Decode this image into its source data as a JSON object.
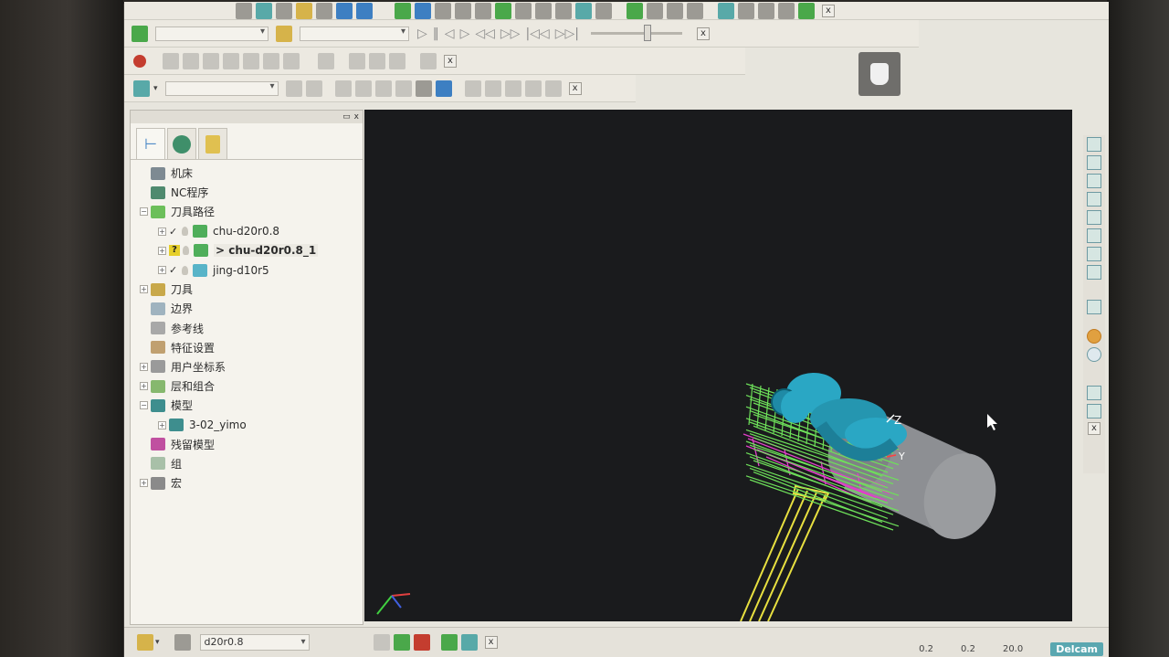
{
  "toolbars": {
    "close_label": "x"
  },
  "explorer": {
    "tabs": [
      {
        "name": "tree-tab",
        "icon": "tree-icon"
      },
      {
        "name": "globe-tab",
        "icon": "globe-icon"
      },
      {
        "name": "bin-tab",
        "icon": "bin-icon"
      }
    ],
    "tree": {
      "machine": "机床",
      "nc_program": "NC程序",
      "toolpaths": "刀具路径",
      "toolpath_items": [
        {
          "label": "chu-d20r0.8",
          "check": "✓",
          "active": false
        },
        {
          "label": "> chu-d20r0.8_1",
          "check": "?",
          "active": true
        },
        {
          "label": "jing-d10r5",
          "check": "✓",
          "active": false
        }
      ],
      "tools": "刀具",
      "boundaries": "边界",
      "reference_lines": "参考线",
      "feature_settings": "特征设置",
      "user_coordinates": "用户坐标系",
      "levels": "层和组合",
      "models": "模型",
      "model_items": [
        "3-02_yimo"
      ],
      "stock_model": "残留模型",
      "groups": "组",
      "macros": "宏"
    }
  },
  "viewport": {
    "axis_z": "Z",
    "axis_y": "Y"
  },
  "statusbar": {
    "tool_name": "d20r0.8",
    "val1": "0.2",
    "val2": "0.2",
    "val3": "20.0",
    "brand": "Delcam"
  },
  "colors": {
    "viewport_bg": "#1a1b1d",
    "model": "#2aa7c4",
    "stock": "#8d8f93",
    "toolpath_green": "#6ee05a",
    "toolpath_magenta": "#e040c8",
    "lead_yellow": "#e8e040"
  }
}
